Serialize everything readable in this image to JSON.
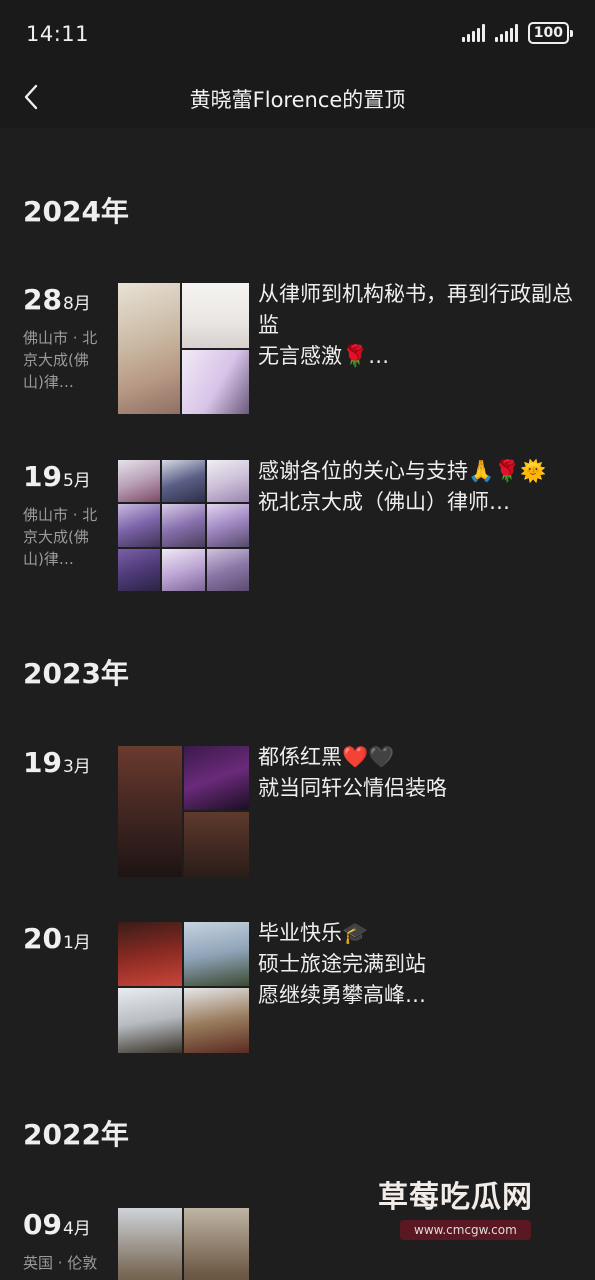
{
  "status": {
    "time": "14:11",
    "battery": "100"
  },
  "nav": {
    "title": "黄晓蕾Florence的置顶"
  },
  "years": [
    "2024年",
    "2023年",
    "2022年"
  ],
  "posts": [
    {
      "day": "28",
      "month": "8月",
      "location": "佛山市 · 北京大成(佛山)律…",
      "caption": [
        "从律师到机构秘书，再到行政副总监",
        "无言感激🌹…"
      ]
    },
    {
      "day": "19",
      "month": "5月",
      "location": "佛山市 · 北京大成(佛山)律…",
      "caption": [
        "感谢各位的关心与支持🙏🌹🌞",
        "祝北京大成（佛山）律师…"
      ]
    },
    {
      "day": "19",
      "month": "3月",
      "location": "",
      "caption": [
        "都係红黑❤️🖤",
        "就当同轩公情侣装咯"
      ]
    },
    {
      "day": "20",
      "month": "1月",
      "location": "",
      "caption": [
        "毕业快乐🎓",
        "硕士旅途完满到站",
        "愿继续勇攀高峰…"
      ]
    },
    {
      "day": "09",
      "month": "4月",
      "location": "英国 · 伦敦",
      "caption": []
    }
  ],
  "watermark": {
    "text": "草莓吃瓜网",
    "url": "www.cmcgw.com"
  }
}
